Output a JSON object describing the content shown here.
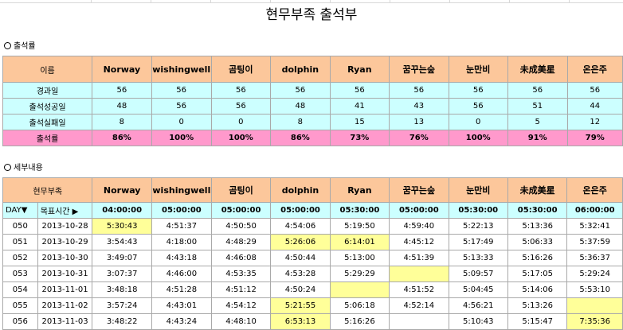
{
  "title": "현무부족 출석부",
  "summary": {
    "section_label": "출석률",
    "header": [
      "이름",
      "Norway",
      "wishingwell",
      "곰팅이",
      "dolphin",
      "Ryan",
      "꿈꾸는숲",
      "눈만비",
      "未成美星",
      "온은주"
    ],
    "rows": [
      {
        "label": "경과일",
        "values": [
          "56",
          "56",
          "56",
          "56",
          "56",
          "56",
          "56",
          "56",
          "56"
        ]
      },
      {
        "label": "출석성공일",
        "values": [
          "48",
          "56",
          "56",
          "48",
          "41",
          "43",
          "56",
          "51",
          "44"
        ]
      },
      {
        "label": "출석실패일",
        "values": [
          "8",
          "0",
          "0",
          "8",
          "15",
          "13",
          "0",
          "5",
          "12"
        ]
      }
    ],
    "rate": {
      "label": "출석률",
      "values": [
        "86%",
        "100%",
        "100%",
        "86%",
        "73%",
        "76%",
        "100%",
        "91%",
        "79%"
      ]
    }
  },
  "detail": {
    "section_label": "세부내용",
    "header": [
      "현무부족",
      "Norway",
      "wishingwell",
      "곰팅이",
      "dolphin",
      "Ryan",
      "꿈꾸는숲",
      "눈만비",
      "未成美星",
      "온은주"
    ],
    "day_label": "DAY▼",
    "target_label": "목표시간 ▶",
    "targets": [
      "04:00:00",
      "05:00:00",
      "05:00:00",
      "05:00:00",
      "05:30:00",
      "05:00:00",
      "05:30:00",
      "05:30:00",
      "06:00:00"
    ],
    "rows": [
      {
        "day": "050",
        "date": "2013-10-28",
        "times": [
          "5:30:43",
          "4:51:37",
          "4:50:50",
          "4:54:06",
          "5:19:50",
          "4:59:40",
          "5:22:13",
          "5:13:36",
          "5:32:41"
        ],
        "late": [
          0
        ]
      },
      {
        "day": "051",
        "date": "2013-10-29",
        "times": [
          "3:54:43",
          "4:18:00",
          "4:48:29",
          "5:26:06",
          "6:14:01",
          "4:45:12",
          "5:17:49",
          "5:06:33",
          "5:37:59"
        ],
        "late": [
          3,
          4
        ]
      },
      {
        "day": "052",
        "date": "2013-10-30",
        "times": [
          "3:49:07",
          "4:43:18",
          "4:46:08",
          "4:50:44",
          "5:13:00",
          "4:51:39",
          "5:13:33",
          "5:16:26",
          "5:36:37"
        ],
        "late": []
      },
      {
        "day": "053",
        "date": "2013-10-31",
        "times": [
          "3:07:37",
          "4:46:00",
          "4:53:35",
          "4:53:28",
          "5:29:29",
          "",
          "5:09:57",
          "5:17:05",
          "5:29:24"
        ],
        "late": [
          5
        ]
      },
      {
        "day": "054",
        "date": "2013-11-01",
        "times": [
          "3:48:18",
          "4:51:28",
          "4:51:12",
          "4:50:24",
          "",
          "4:51:52",
          "5:04:45",
          "5:14:06",
          "5:53:10"
        ],
        "late": [
          4
        ]
      },
      {
        "day": "055",
        "date": "2013-11-02",
        "times": [
          "3:57:24",
          "4:43:01",
          "4:54:12",
          "5:21:55",
          "5:06:18",
          "4:52:14",
          "4:56:21",
          "5:13:26",
          ""
        ],
        "late": [
          3,
          8
        ]
      },
      {
        "day": "056",
        "date": "2013-11-03",
        "times": [
          "3:48:22",
          "4:43:24",
          "4:48:10",
          "6:53:13",
          "5:16:26",
          "",
          "5:10:43",
          "5:15:47",
          "7:35:36"
        ],
        "late": [
          3,
          8
        ]
      }
    ]
  },
  "colors": {
    "header": "#fcc79b",
    "cyan": "#ccffff",
    "rate": "#ff99cc",
    "late": "#ffff99"
  }
}
